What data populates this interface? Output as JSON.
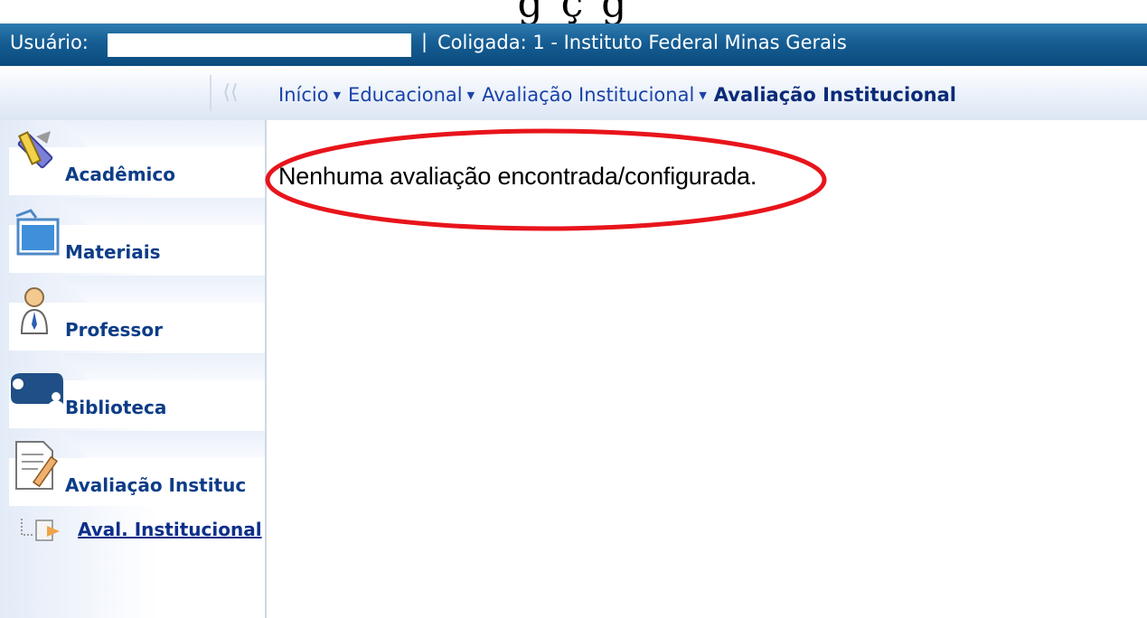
{
  "header": {
    "user_label": "Usuário:",
    "separator": "|",
    "coligada": "Coligada: 1 - Instituto Federal Minas Gerais",
    "background_color": "#155d93"
  },
  "breadcrumb": {
    "collapse_glyph": "⟨⟨",
    "items": [
      "Início",
      "Educacional",
      "Avaliação Institucional"
    ],
    "current": "Avaliação Institucional",
    "arrow_glyph": "▼"
  },
  "sidebar": {
    "items": [
      {
        "label": "Acadêmico",
        "icon": "ruler-pencil-icon"
      },
      {
        "label": "Materiais",
        "icon": "folder-document-icon"
      },
      {
        "label": "Professor",
        "icon": "teacher-avatar-icon"
      },
      {
        "label": "Biblioteca",
        "icon": "book-scroll-icon"
      },
      {
        "label": "Avaliação Instituc",
        "icon": "document-pencil-icon"
      }
    ],
    "subitem": {
      "label": "Aval. Institucional",
      "icon": "tree-arrow-icon"
    }
  },
  "main": {
    "message": "Nenhuma avaliação encontrada/configurada.",
    "highlight_color": "#e8141b"
  }
}
